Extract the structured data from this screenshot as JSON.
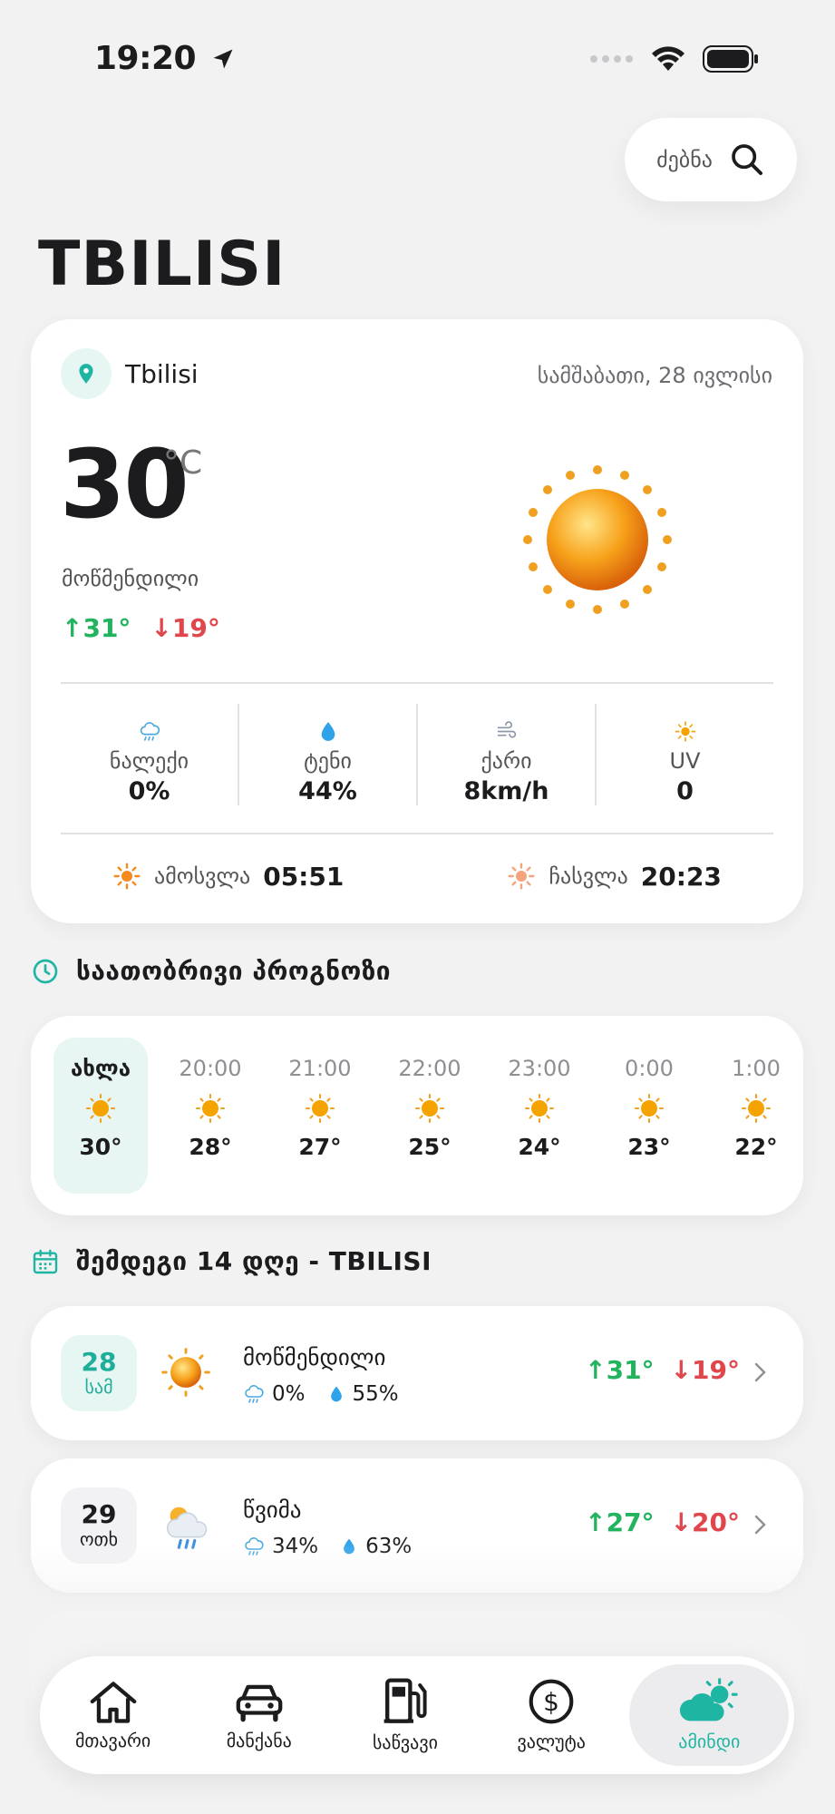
{
  "status": {
    "time": "19:20"
  },
  "search": {
    "label": "ძებნა"
  },
  "city_title": "TBILISI",
  "current": {
    "location": "Tbilisi",
    "date": "სამშაბათი, 28 ივლისი",
    "temp": "30",
    "unit": "°C",
    "condition": "მოწმენდილი",
    "high": "↑31°",
    "low": "↓19°",
    "stats": [
      {
        "label": "ნალექი",
        "value": "0%"
      },
      {
        "label": "ტენი",
        "value": "44%"
      },
      {
        "label": "ქარი",
        "value": "8km/h"
      },
      {
        "label": "UV",
        "value": "0"
      }
    ],
    "sunrise_label": "ამოსვლა",
    "sunrise": "05:51",
    "sunset_label": "ჩასვლა",
    "sunset": "20:23"
  },
  "hourly": {
    "title": "საათობრივი პროგნოზი",
    "items": [
      {
        "time": "ახლა",
        "temp": "30°"
      },
      {
        "time": "20:00",
        "temp": "28°"
      },
      {
        "time": "21:00",
        "temp": "27°"
      },
      {
        "time": "22:00",
        "temp": "25°"
      },
      {
        "time": "23:00",
        "temp": "24°"
      },
      {
        "time": "0:00",
        "temp": "23°"
      },
      {
        "time": "1:00",
        "temp": "22°"
      }
    ]
  },
  "daily": {
    "title": "შემდეგი 14 დღე - TBILISI",
    "items": [
      {
        "day": "28",
        "dow": "სამ",
        "condition": "მოწმენდილი",
        "precip": "0%",
        "humidity": "55%",
        "high": "↑31°",
        "low": "↓19°"
      },
      {
        "day": "29",
        "dow": "ოთხ",
        "condition": "წვიმა",
        "precip": "34%",
        "humidity": "63%",
        "high": "↑27°",
        "low": "↓20°"
      }
    ]
  },
  "tabs": [
    {
      "label": "მთავარი",
      "icon": "home-icon"
    },
    {
      "label": "მანქანა",
      "icon": "car-icon"
    },
    {
      "label": "საწვავი",
      "icon": "fuel-icon"
    },
    {
      "label": "ვალუტა",
      "icon": "dollar-icon"
    },
    {
      "label": "ამინდი",
      "icon": "weather-icon",
      "active": true
    }
  ],
  "colors": {
    "accent": "#1fb5a3",
    "high": "#22b35e",
    "low": "#e0474c",
    "sun": "#f5a300"
  }
}
